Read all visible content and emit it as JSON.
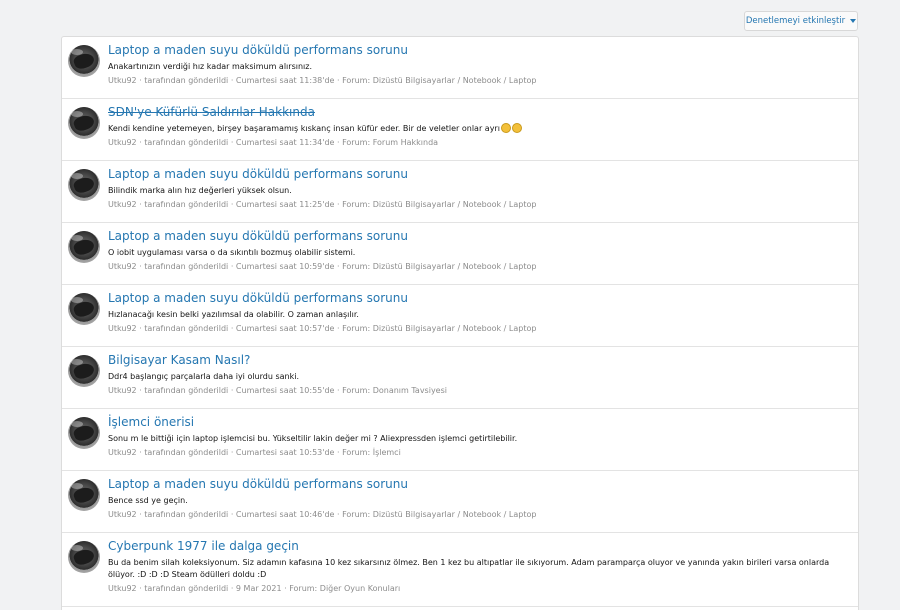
{
  "page": {
    "partial_title": ""
  },
  "toolbar": {
    "moderation_label": "Denetlemeyi etkinleştir"
  },
  "results": [
    {
      "title": "Laptop a maden suyu döküldü performans sorunu",
      "deleted": false,
      "snippet": "Anakartınızın verdiği hız kadar maksimum alırsınız.",
      "author": "Utku92",
      "posted_text": " · tarafından gönderildi · ",
      "time": "Cumartesi saat 11:38'de",
      "forum_prefix": " · Forum: ",
      "forum": "Dizüstü Bilgisayarlar / Notebook / Laptop"
    },
    {
      "title": "SDN'ye Küfürlü Saldırılar Hakkında",
      "deleted": true,
      "snippet": "Kendi kendine yetemeyen, birşey başaramamış kıskanç insan küfür eder. Bir de veletler onlar ayrı",
      "author": "Utku92",
      "posted_text": " · tarafından gönderildi · ",
      "time": "Cumartesi saat 11:34'de",
      "forum_prefix": " · Forum: ",
      "forum": "Forum Hakkında"
    },
    {
      "title": "Laptop a maden suyu döküldü performans sorunu",
      "deleted": false,
      "snippet": "Bilindik marka alın hız değerleri yüksek olsun.",
      "author": "Utku92",
      "posted_text": " · tarafından gönderildi · ",
      "time": "Cumartesi saat 11:25'de",
      "forum_prefix": " · Forum: ",
      "forum": "Dizüstü Bilgisayarlar / Notebook / Laptop"
    },
    {
      "title": "Laptop a maden suyu döküldü performans sorunu",
      "deleted": false,
      "snippet": "O iobit uygulaması varsa o da sıkıntılı bozmuş olabilir sistemi.",
      "author": "Utku92",
      "posted_text": " · tarafından gönderildi · ",
      "time": "Cumartesi saat 10:59'de",
      "forum_prefix": " · Forum: ",
      "forum": "Dizüstü Bilgisayarlar / Notebook / Laptop"
    },
    {
      "title": "Laptop a maden suyu döküldü performans sorunu",
      "deleted": false,
      "snippet": "Hızlanacağı kesin belki yazılımsal da olabilir. O zaman anlaşılır.",
      "author": "Utku92",
      "posted_text": " · tarafından gönderildi · ",
      "time": "Cumartesi saat 10:57'de",
      "forum_prefix": " · Forum: ",
      "forum": "Dizüstü Bilgisayarlar / Notebook / Laptop"
    },
    {
      "title": "Bilgisayar Kasam Nasıl?",
      "deleted": false,
      "snippet": "Ddr4 başlangıç parçalarla daha iyi olurdu sanki.",
      "author": "Utku92",
      "posted_text": " · tarafından gönderildi · ",
      "time": "Cumartesi saat 10:55'de",
      "forum_prefix": " · Forum: ",
      "forum": "Donanım Tavsiyesi"
    },
    {
      "title": "İşlemci önerisi",
      "deleted": false,
      "snippet": "Sonu m le bittiği için laptop işlemcisi bu. Yükseltilir lakin değer mi ? Aliexpressden işlemci getirtilebilir.",
      "author": "Utku92",
      "posted_text": " · tarafından gönderildi · ",
      "time": "Cumartesi saat 10:53'de",
      "forum_prefix": " · Forum: ",
      "forum": "İşlemci"
    },
    {
      "title": "Laptop a maden suyu döküldü performans sorunu",
      "deleted": false,
      "snippet": "Bence ssd ye geçin.",
      "author": "Utku92",
      "posted_text": " · tarafından gönderildi · ",
      "time": "Cumartesi saat 10:46'de",
      "forum_prefix": " · Forum: ",
      "forum": "Dizüstü Bilgisayarlar / Notebook / Laptop"
    },
    {
      "title": "Cyberpunk 1977 ile dalga geçin",
      "deleted": false,
      "snippet": "Bu da benim silah koleksiyonum. Siz adamın kafasına 10 kez sıkarsınız ölmez. Ben 1 kez bu altıpatlar ile sıkıyorum. Adam paramparça oluyor ve yanında yakın birileri varsa onlarda ölüyor. :D :D :D Steam ödülleri doldu :D",
      "author": "Utku92",
      "posted_text": " · tarafından gönderildi · ",
      "time": "9 Mar 2021",
      "forum_prefix": " · Forum: ",
      "forum": "Diğer Oyun Konuları"
    }
  ]
}
